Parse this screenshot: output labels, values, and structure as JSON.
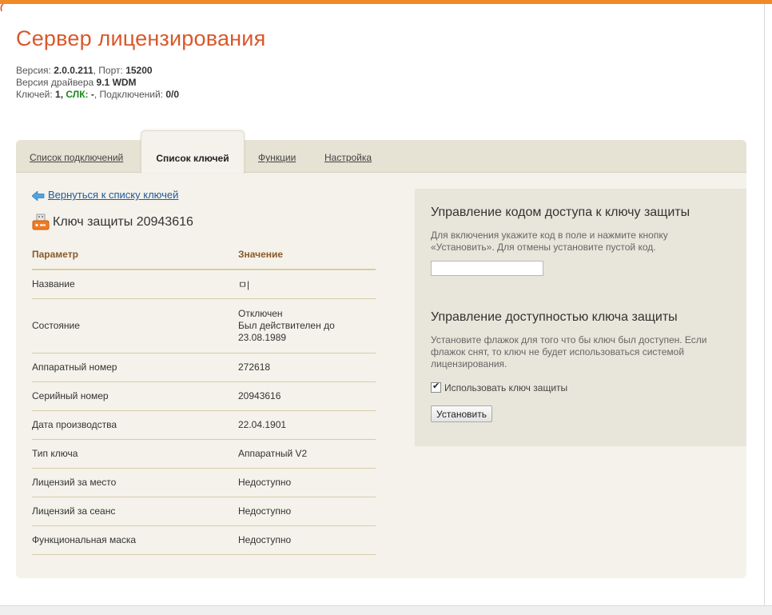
{
  "header": {
    "title": "Сервер лицензирования",
    "version_label": "Версия:",
    "version_value": "2.0.0.211",
    "port_label": ", Порт:",
    "port_value": "15200",
    "driver_label": "Версия драйвера",
    "driver_value": "9.1 WDM",
    "keys_label": "Ключей:",
    "keys_value": "1,",
    "slk_label": "СЛК:",
    "slk_value": "-",
    "connections_label": ", Подключений:",
    "connections_value": "0/0"
  },
  "tabs": [
    {
      "label": "Список подключений"
    },
    {
      "label": "Список ключей"
    },
    {
      "label": "Функции"
    },
    {
      "label": "Настройка"
    }
  ],
  "active_tab": "Список ключей",
  "back_link": "Вернуться к списку ключей",
  "key_title": "Ключ защиты 20943616",
  "table": {
    "headers": [
      "Параметр",
      "Значение"
    ],
    "rows": [
      {
        "param": "Название",
        "value": "ㅁ|"
      },
      {
        "param": "Состояние",
        "value_lines": [
          "Отключен",
          "Был действителен до",
          "23.08.1989"
        ]
      },
      {
        "param": "Аппаратный номер",
        "value": "272618"
      },
      {
        "param": "Серийный номер",
        "value": "20943616"
      },
      {
        "param": "Дата производства",
        "value": "22.04.1901"
      },
      {
        "param": "Тип ключа",
        "value": "Аппаратный V2"
      },
      {
        "param": "Лицензий за место",
        "value": "Недоступно"
      },
      {
        "param": "Лицензий за сеанс",
        "value": "Недоступно"
      },
      {
        "param": "Функциональная маска",
        "value": "Недоступно"
      }
    ]
  },
  "access_code": {
    "heading": "Управление кодом доступа к ключу защиты",
    "description": "Для включения укажите код в поле и нажмите кнопку «Установить». Для отмены установите пустой код.",
    "input_value": ""
  },
  "availability": {
    "heading": "Управление доступностью ключа защиты",
    "description": "Установите флажок для того что бы ключ был доступен. Если флажок снят, то ключ не будет использоваться системой лицензирования.",
    "checkbox_label": "Использовать ключ защиты",
    "checkbox_checked": true,
    "button_label": "Установить"
  },
  "colors": {
    "accent": "#f08a28",
    "title": "#d9582b",
    "link": "#1e5aa0",
    "panel": "#f4f2ea",
    "sidebox": "#e8e5da"
  },
  "icons": {
    "back": "arrow-left-icon",
    "key": "usb-key-icon"
  }
}
